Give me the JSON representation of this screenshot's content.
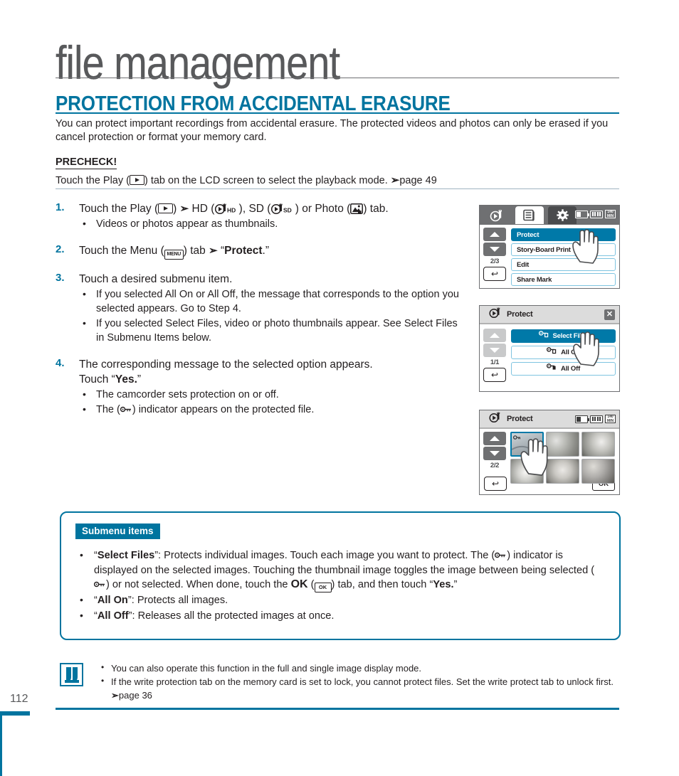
{
  "header": {
    "chapter_title": "file management",
    "section_title": "PROTECTION FROM ACCIDENTAL ERASURE",
    "intro": "You can protect important recordings from accidental erasure. The protected videos and photos can only be erased if you cancel protection or format your memory card.",
    "precheck_label": "PRECHECK!",
    "precheck_text_before": "Touch the Play (",
    "precheck_text_after": ") tab on the LCD screen to select the playback mode. ",
    "precheck_page_ref": "page 49"
  },
  "steps": [
    {
      "num": "1.",
      "title_parts": [
        "Touch the Play (",
        ") ",
        " HD (",
        " ), SD (",
        " ) or Photo (",
        ") tab."
      ],
      "bullets": [
        "Videos or photos appear as thumbnails."
      ]
    },
    {
      "num": "2.",
      "title_parts": [
        "Touch the Menu (",
        ") tab ",
        " “",
        "Protect",
        ".”"
      ],
      "bullets": []
    },
    {
      "num": "3.",
      "title": "Touch a desired submenu item.",
      "bullets": [
        "If you selected All On or All Off, the message that corresponds to the option you selected appears. Go to Step 4.",
        "If you selected Select Files, video or photo thumbnails appear. See Select Files in Submenu Items below."
      ]
    },
    {
      "num": "4.",
      "title_line1": "The corresponding message to the selected option appears.",
      "title_line2_pre": "Touch “",
      "title_line2_bold": "Yes.",
      "title_line2_post": "”",
      "bullets": [
        "The camcorder sets protection on or off.",
        "The ( ) indicator appears on the protected file."
      ]
    }
  ],
  "lcd_screen_1": {
    "tabs": [
      "play-tab",
      "menu-tab",
      "settings-tab"
    ],
    "pager": "2/3",
    "menu_items": [
      {
        "label": "Protect",
        "selected": true
      },
      {
        "label": "Story-Board Print",
        "selected": false
      },
      {
        "label": "Edit",
        "selected": false
      },
      {
        "label": "Share Mark",
        "selected": false
      }
    ],
    "back_label": "↩"
  },
  "lcd_screen_2": {
    "title": "Protect",
    "close": "✕",
    "pager": "1/1",
    "menu_items": [
      {
        "label": "Select Files",
        "selected": true
      },
      {
        "label": "All On",
        "selected": false
      },
      {
        "label": "All Off",
        "selected": false
      }
    ],
    "back_label": "↩"
  },
  "lcd_screen_3": {
    "title": "Protect",
    "pager": "2/2",
    "ok_label": "OK",
    "back_label": "↩",
    "thumbnail_count": 6,
    "selected_thumbnail_index": 0
  },
  "submenu": {
    "badge": "Submenu items",
    "items": [
      {
        "p1": "“",
        "bold1": "Select Files",
        "p2": "”: Protects individual images. Touch each image you want to protect. The (",
        "p3": ") indicator is displayed on the selected images. Touching the thumbnail image toggles the image between being selected (",
        "p4": ") or not selected. When done, touch the ",
        "bold2": "OK",
        "p5": " (",
        "p6": ") tab, and then touch “",
        "bold3": "Yes.",
        "p7": "”"
      },
      {
        "p1": "“",
        "bold1": "All On",
        "p2": "”: Protects all images."
      },
      {
        "p1": "“",
        "bold1": "All Off",
        "p2": "”: Releases all the protected images at once."
      }
    ]
  },
  "notes": [
    "You can also operate this function in the full and single image display mode.",
    "If the write protection tab on the memory card is set to lock, you cannot protect files. Set the write protect tab to unlock first. "
  ],
  "notes_page_ref": "page 36",
  "page_number": "112",
  "colors": {
    "accent": "#00749f",
    "lcd_select": "#0079a8",
    "gray_title": "#58595b"
  }
}
